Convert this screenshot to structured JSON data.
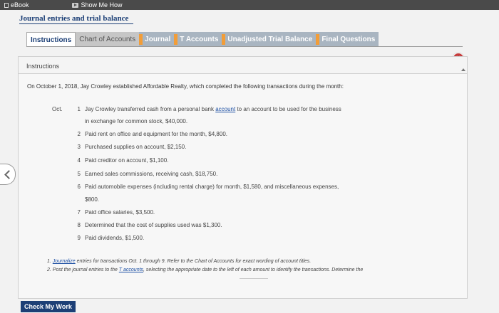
{
  "topbar": {
    "ebook_label": "eBook",
    "show_me_label": "Show Me How"
  },
  "page_title": "Journal entries and trial balance",
  "tabs": [
    {
      "label": "Instructions",
      "state": "active",
      "warning": false
    },
    {
      "label": "Chart of Accounts",
      "state": "inactive",
      "warning": false
    },
    {
      "label": "Journal",
      "state": "inactive",
      "warning": true
    },
    {
      "label": "T Accounts",
      "state": "inactive",
      "warning": true
    },
    {
      "label": "Unadjusted Trial Balance",
      "state": "inactive",
      "warning": true
    },
    {
      "label": "Final Questions",
      "state": "inactive",
      "warning": true
    }
  ],
  "colors": {
    "warning": "#f29d38",
    "close": "#c43c3c",
    "primary": "#1c3f76",
    "link": "#1c4fa3"
  },
  "panel": {
    "heading": "Instructions",
    "intro": "On October 1, 2018, Jay Crowley established Affordable Realty, which completed the following transactions during the month:",
    "month": "Oct.",
    "transactions": [
      {
        "num": "1",
        "line1_pre": "Jay Crowley transferred cash from a personal bank ",
        "line1_link": "account",
        "line1_post": " to an account to be used for the business",
        "line2": "in exchange for common stock, $40,000."
      },
      {
        "num": "2",
        "text": "Paid rent on office and equipment for the month, $4,800."
      },
      {
        "num": "3",
        "text": "Purchased supplies on account, $2,150."
      },
      {
        "num": "4",
        "text": "Paid creditor on account, $1,100."
      },
      {
        "num": "5",
        "text": "Earned sales commissions, receiving cash, $18,750."
      },
      {
        "num": "6",
        "text": "Paid automobile expenses (including rental charge) for month, $1,580, and miscellaneous expenses,",
        "line2": "$800."
      },
      {
        "num": "7",
        "text": "Paid office salaries, $3,500."
      },
      {
        "num": "8",
        "text": "Determined that the cost of supplies used was $1,300."
      },
      {
        "num": "9",
        "text": "Paid dividends, $1,500."
      }
    ],
    "notes": {
      "n1_num": "1.",
      "n1_link": "Journalize",
      "n1_text": " entries for transactions Oct. 1 through 9. Refer to the Chart of Accounts for exact wording of account titles.",
      "n2_num": "2.",
      "n2_pre": "Post the journal entries to the ",
      "n2_link": "T accounts",
      "n2_post": ", selecting the appropriate date to the left of each amount to identify the transactions. Determine the"
    }
  },
  "close_icon_glyph": "×",
  "check_button_label": "Check My Work"
}
